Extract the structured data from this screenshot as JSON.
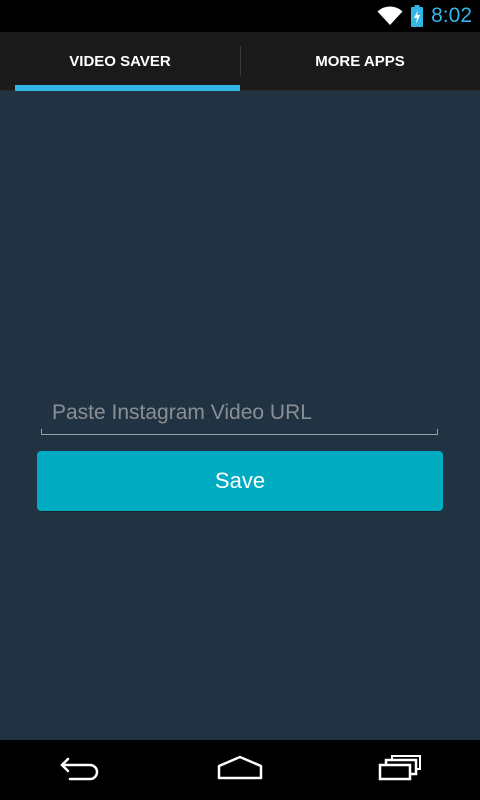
{
  "status_bar": {
    "time": "8:02",
    "wifi_icon": "wifi-icon",
    "battery_icon": "battery-charging-icon",
    "accent_color": "#33b5e5"
  },
  "tabs": [
    {
      "label": "VIDEO SAVER",
      "selected": true
    },
    {
      "label": "MORE APPS",
      "selected": false
    }
  ],
  "form": {
    "url_placeholder": "Paste Instagram Video URL",
    "url_value": "",
    "save_label": "Save"
  },
  "nav_bar": {
    "back_icon": "back-icon",
    "home_icon": "home-icon",
    "recent_icon": "recent-apps-icon"
  },
  "colors": {
    "background": "#213343",
    "tab_bar": "#1a1a1a",
    "tab_indicator": "#33b5e5",
    "button": "#00acc1"
  }
}
